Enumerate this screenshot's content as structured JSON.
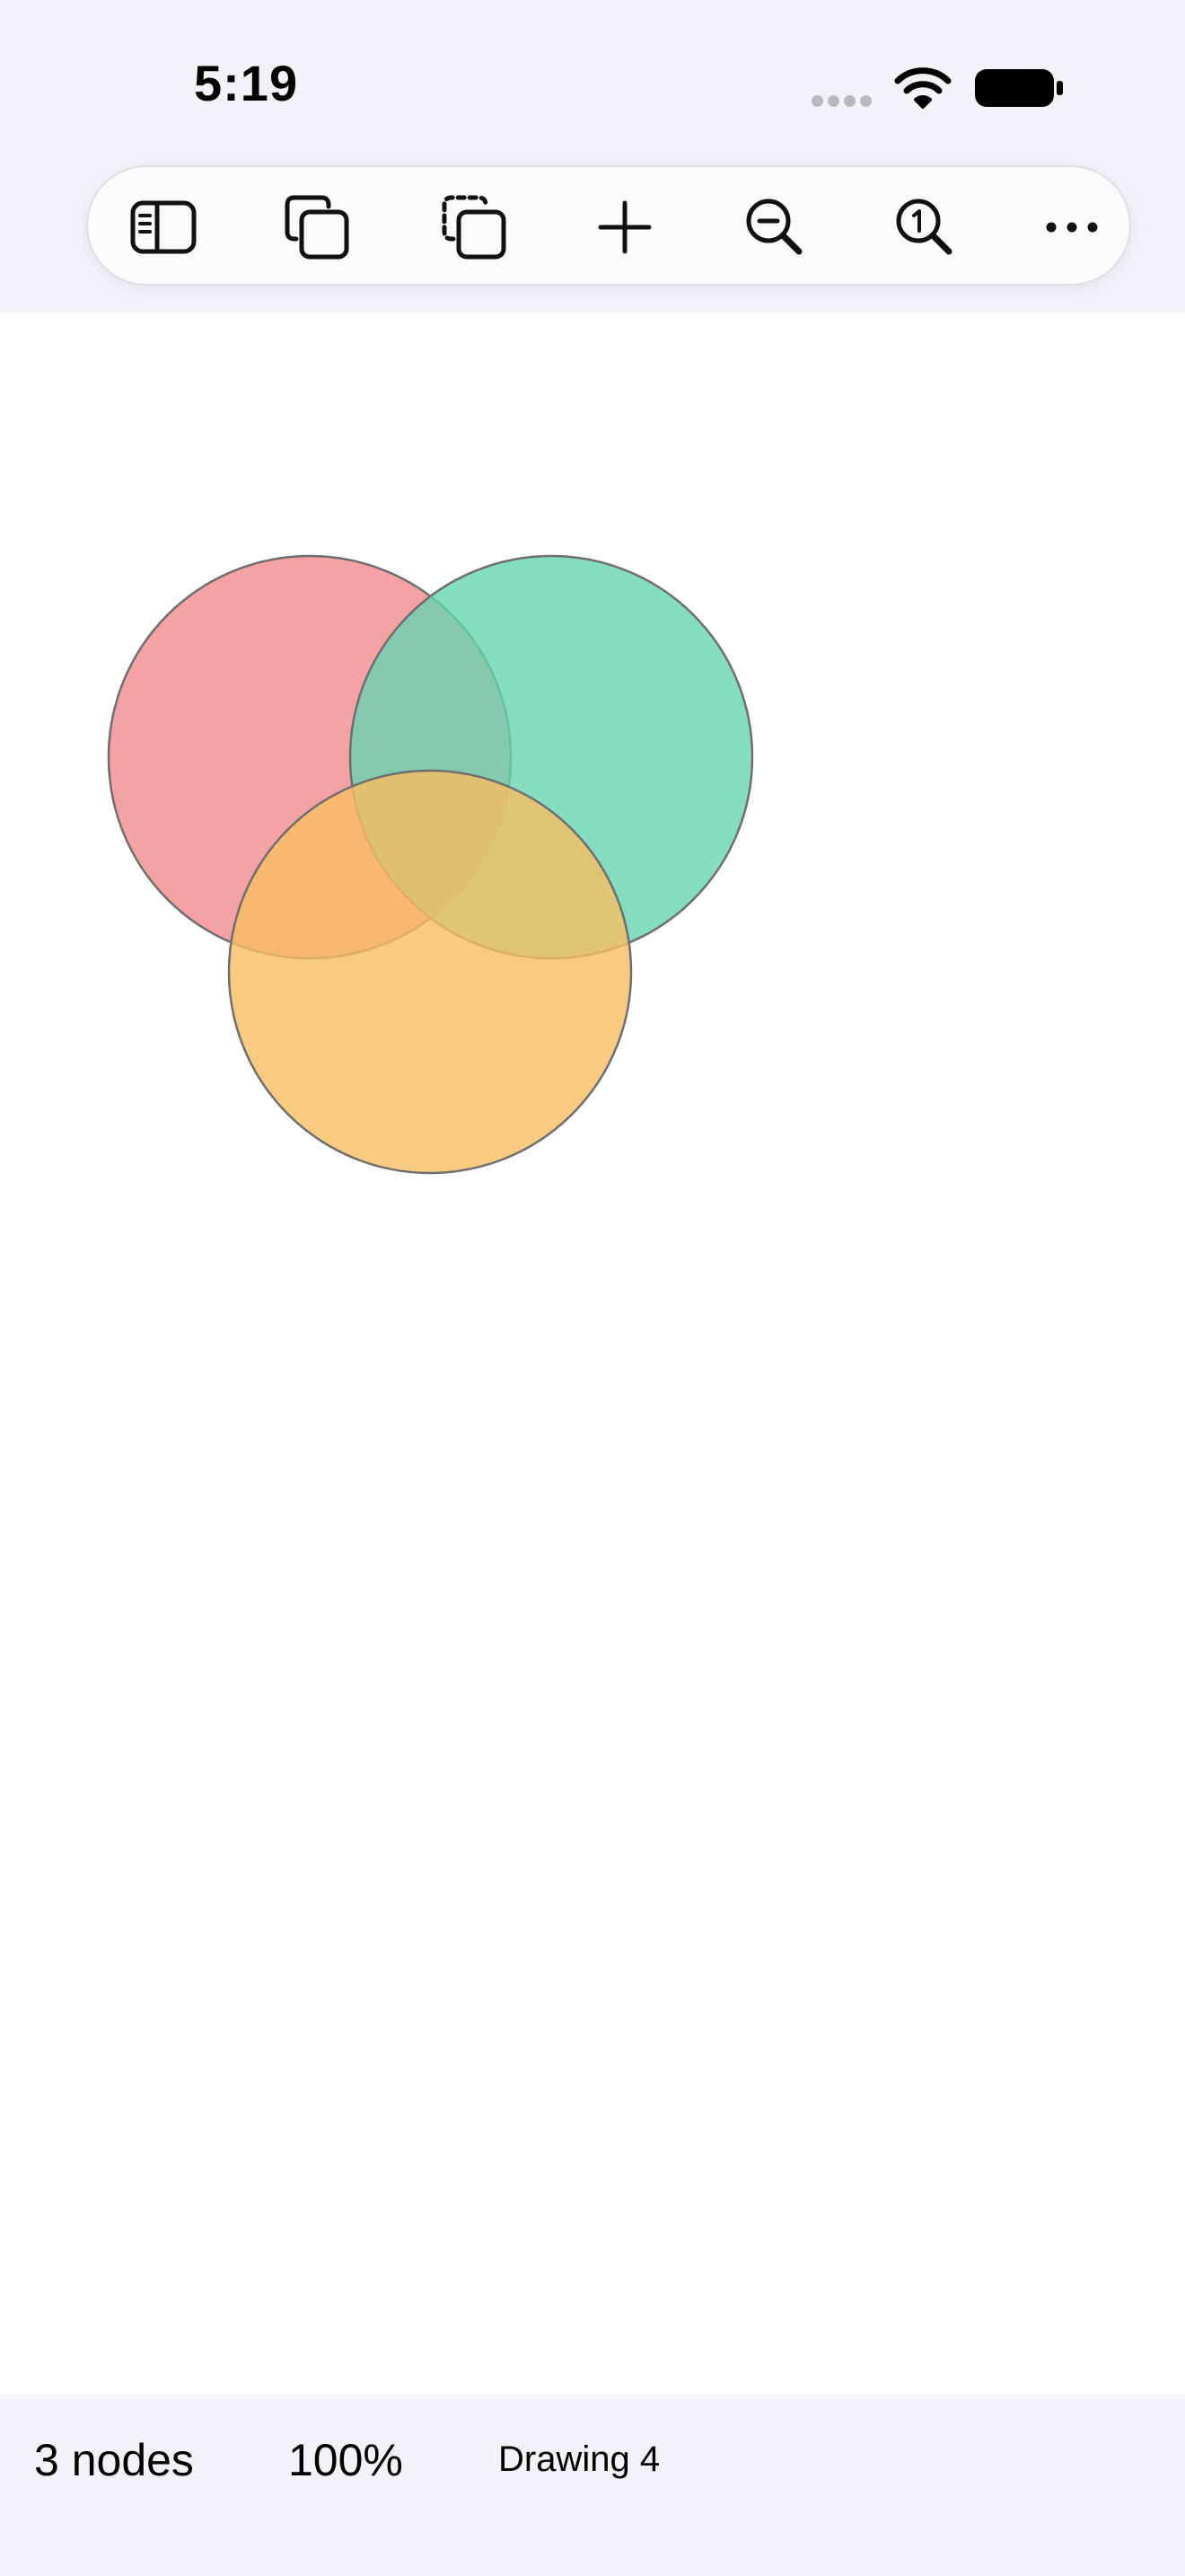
{
  "status_bar": {
    "time": "5:19"
  },
  "toolbar": {
    "buttons": [
      {
        "name": "sidebar",
        "icon": "sidebar-icon"
      },
      {
        "name": "duplicate",
        "icon": "duplicate-icon"
      },
      {
        "name": "paste",
        "icon": "paste-copy-icon"
      },
      {
        "name": "add",
        "icon": "plus-icon"
      },
      {
        "name": "zoom-out",
        "icon": "zoom-out-icon"
      },
      {
        "name": "zoom-actual",
        "icon": "zoom-actual-size-icon"
      },
      {
        "name": "more",
        "icon": "ellipsis-icon"
      }
    ]
  },
  "canvas": {
    "shapes": [
      {
        "type": "circle",
        "fill": "#f28b8f",
        "stroke": "#6e6e6e",
        "opacity": 0.8
      },
      {
        "type": "circle",
        "fill": "#66d4b1",
        "stroke": "#6e6e6e",
        "opacity": 0.8
      },
      {
        "type": "circle",
        "fill": "#f7be62",
        "stroke": "#6e6e6e",
        "opacity": 0.8
      }
    ]
  },
  "bottom_bar": {
    "node_count": "3 nodes",
    "zoom": "100%",
    "document_name": "Drawing 4"
  },
  "colors": {
    "chrome_background": "#f2f2f7",
    "canvas_background": "#ffffff",
    "icon_color": "#111111"
  }
}
